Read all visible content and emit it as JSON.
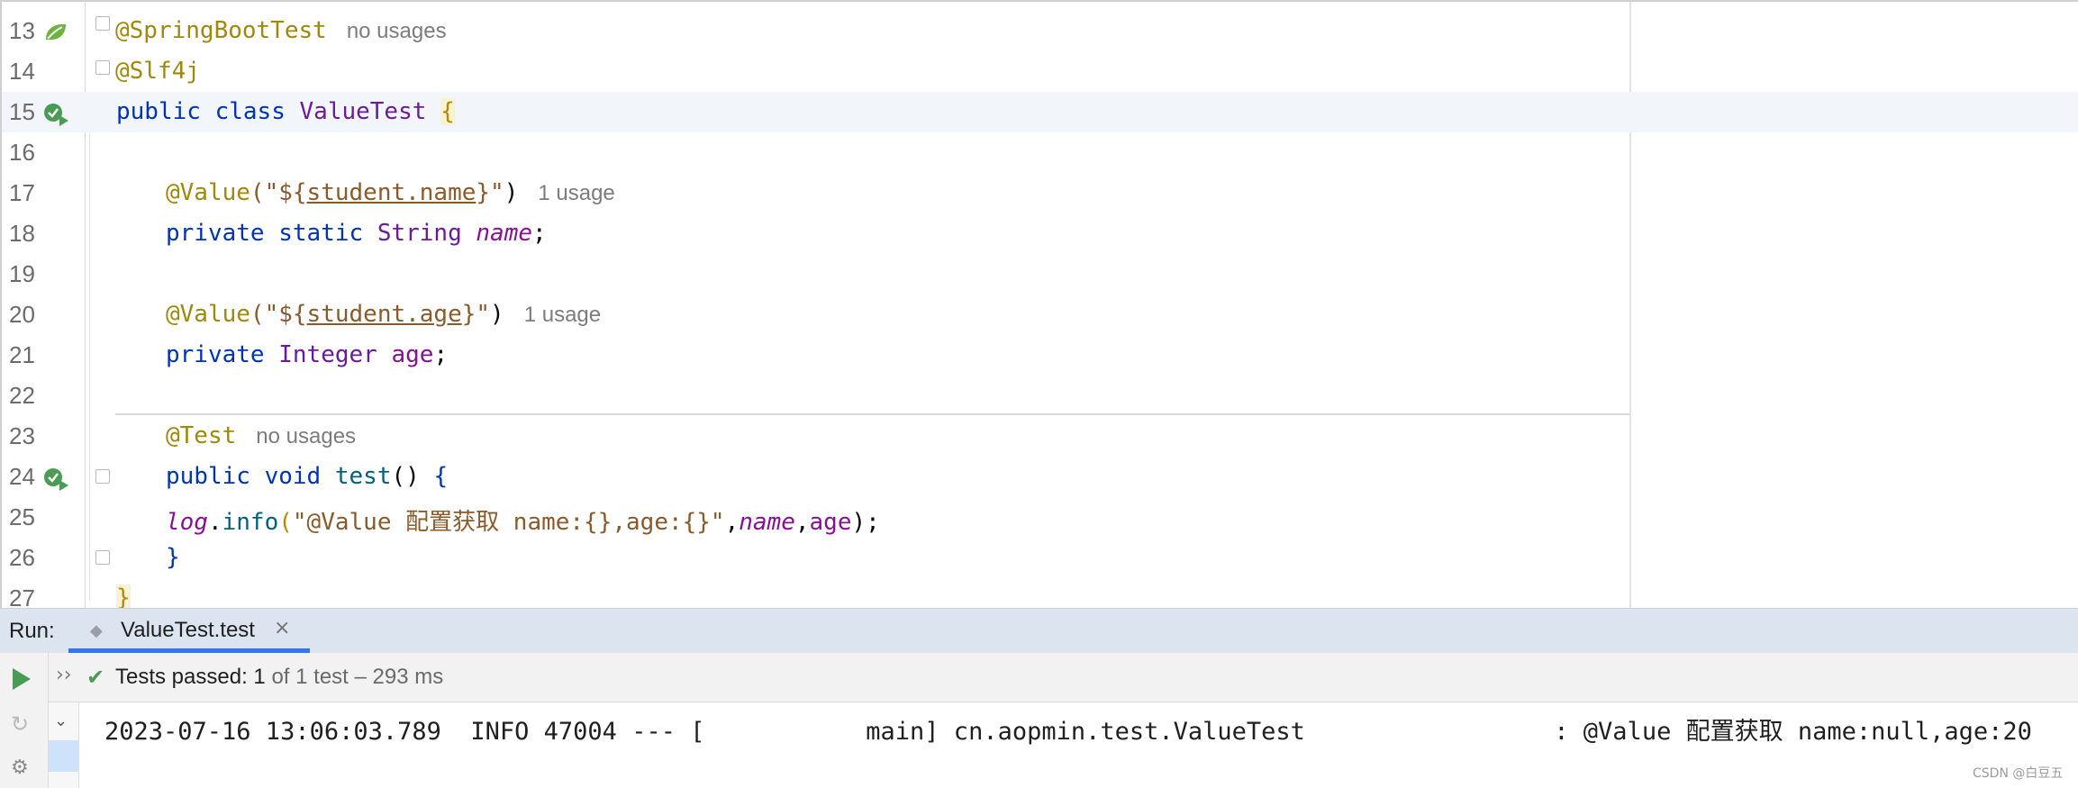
{
  "editor": {
    "lines": [
      {
        "num": "13",
        "annotation": "@SpringBootTest",
        "hint": "no usages"
      },
      {
        "num": "14",
        "annotation": "@Slf4j"
      },
      {
        "num": "15",
        "kw1": "public",
        "kw2": "class",
        "name": "ValueTest",
        "brace": "{"
      },
      {
        "num": "16"
      },
      {
        "num": "17",
        "ann": "@Value",
        "open": "(\"",
        "dollar": "${",
        "key": "student.name",
        "close": "}\"",
        "paren": ")",
        "hint": "1 usage"
      },
      {
        "num": "18",
        "kw1": "private",
        "kw2": "static",
        "type": "String",
        "field": "name",
        "semi": ";"
      },
      {
        "num": "19"
      },
      {
        "num": "20",
        "ann": "@Value",
        "open": "(\"",
        "dollar": "${",
        "key": "student.age",
        "close": "}\"",
        "paren": ")",
        "hint": "1 usage"
      },
      {
        "num": "21",
        "kw1": "private",
        "type": "Integer",
        "field": "age",
        "semi": ";"
      },
      {
        "num": "22"
      },
      {
        "num": "23",
        "ann": "@Test",
        "hint": "no usages"
      },
      {
        "num": "24",
        "kw1": "public",
        "kw2": "void",
        "method": "test",
        "parens": "()",
        "brace": "{"
      },
      {
        "num": "25",
        "log": "log",
        "dot": ".",
        "info": "info",
        "open": "(",
        "str": "\"@Value 配置获取 name:{},age:{}\"",
        "comma1": ",",
        "arg1": "name",
        "comma2": ",",
        "arg2": "age",
        "close": ");"
      },
      {
        "num": "26",
        "brace": "}"
      },
      {
        "num": "27",
        "brace": "}"
      }
    ]
  },
  "run": {
    "label": "Run:",
    "tab_title": "ValueTest.test",
    "tab_close": "×",
    "status_bold": "Tests passed: ",
    "status_count": "1",
    "status_detail": " of 1 test – 293 ms",
    "more": "››",
    "log_line": "2023-07-16 13:06:03.789  INFO 47004 --- [           main] cn.aopmin.test.ValueTest                 : @Value 配置获取 name:null,age:20"
  },
  "icons": {
    "spring": "spring-leaf-icon",
    "run_gutter": "run-test-icon",
    "play": "play-icon",
    "rerun": "rerun-failed-icon",
    "settings": "settings-icon",
    "check": "check-icon"
  },
  "colors": {
    "keyword": "#0033b3",
    "annotation": "#9e880d",
    "string": "#067d17",
    "field": "#871094",
    "pass": "#4a9b54",
    "tab_accent": "#3574f0"
  },
  "watermark": "CSDN @白豆五"
}
